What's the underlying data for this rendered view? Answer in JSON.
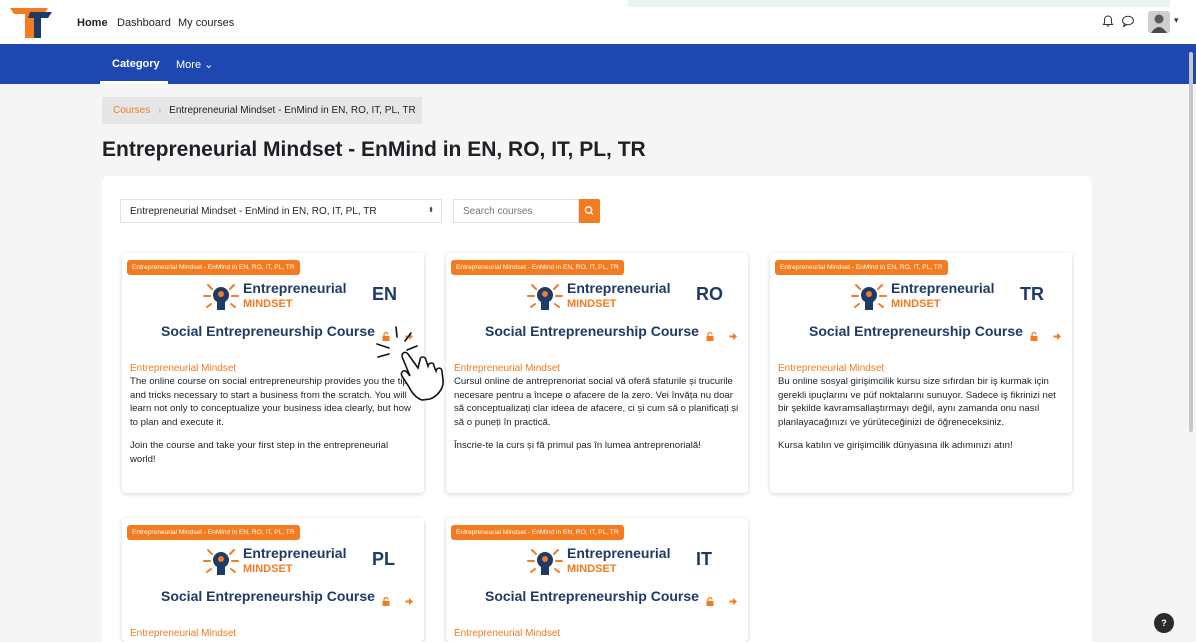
{
  "nav": {
    "home": "Home",
    "dashboard": "Dashboard",
    "my_courses": "My courses"
  },
  "secondary_nav": {
    "category": "Category",
    "more": "More ⌄"
  },
  "breadcrumb": {
    "root": "Courses",
    "separator": "›",
    "current": "Entrepreneurial Mindset - EnMind in EN, RO, IT, PL, TR"
  },
  "page_title": "Entrepreneurial Mindset - EnMind in EN, RO, IT, PL, TR",
  "category_select": {
    "value": "Entrepreneurial Mindset - EnMind in EN, RO, IT, PL, TR",
    "arrow": "⬍"
  },
  "search": {
    "placeholder": "Search courses"
  },
  "colors": {
    "accent": "#f47b20",
    "nav_blue": "#1e47b0",
    "brand_navy": "#1e3a66"
  },
  "icons": [
    "logo-icon",
    "bell-icon",
    "chat-icon",
    "bulb-icon",
    "lock-icon",
    "enrol-icon",
    "search-icon",
    "pointer-hand-icon"
  ],
  "courses": [
    {
      "badge": "Entrepreneurial Mindset - EnMind in EN, RO, IT, PL, TR",
      "brand_line1": "Entrepreneurial",
      "brand_line2": "MINDSET",
      "lang": "EN",
      "image_title": "Social Entrepreneurship Course",
      "category": "Entrepreneurial Mindset",
      "summary_p1": "The online course on social entrepreneurship provides you the tips and tricks necessary to start a business from the scratch. You will learn not only to conceptualize your business idea clearly, but how to plan and execute it.",
      "summary_p2": "Join the course and take your first step in the entrepreneurial world!"
    },
    {
      "badge": "Entrepreneurial Mindset - EnMind in EN, RO, IT, PL, TR",
      "brand_line1": "Entrepreneurial",
      "brand_line2": "MINDSET",
      "lang": "RO",
      "image_title": "Social Entrepreneurship Course",
      "category": "Entrepreneurial Mindset",
      "summary_p1": "Cursul online de antreprenoriat social vă oferă sfaturile și trucurile necesare pentru a începe o afacere de la zero. Vei învăța nu doar să conceptualizați clar ideea de afacere, ci și cum să o planificați și să o puneți în practică.",
      "summary_p2": "Înscrie-te la curs și fă primul pas în lumea antreprenorială!"
    },
    {
      "badge": "Entrepreneurial Mindset - EnMind in EN, RO, IT, PL, TR",
      "brand_line1": "Entrepreneurial",
      "brand_line2": "MINDSET",
      "lang": "TR",
      "image_title": "Social Entrepreneurship Course",
      "category": "Entrepreneurial Mindset",
      "summary_p1": "Bu online sosyal girişimcilik kursu size sıfırdan bir iş kurmak için gerekli ipuçlarını ve püf noktalarını sunuyor. Sadece iş fikrinizi net bir şekilde kavramsallaştırmayı değil, aynı zamanda onu nasıl planlayacağınızı ve yürüteceğinizi de öğreneceksiniz.",
      "summary_p2": "Kursa katılın ve girişimcilik dünyasına ilk adımınızı atın!"
    },
    {
      "badge": "Entrepreneurial Mindset - EnMind in EN, RO, IT, PL, TR",
      "brand_line1": "Entrepreneurial",
      "brand_line2": "MINDSET",
      "lang": "PL",
      "image_title": "Social Entrepreneurship Course",
      "category": "Entrepreneurial Mindset",
      "summary_p1": "",
      "summary_p2": ""
    },
    {
      "badge": "Entrepreneurial Mindset - EnMind in EN, RO, IT, PL, TR",
      "brand_line1": "Entrepreneurial",
      "brand_line2": "MINDSET",
      "lang": "IT",
      "image_title": "Social Entrepreneurship Course",
      "category": "Entrepreneurial Mindset",
      "summary_p1": "",
      "summary_p2": ""
    }
  ],
  "help_label": "?"
}
